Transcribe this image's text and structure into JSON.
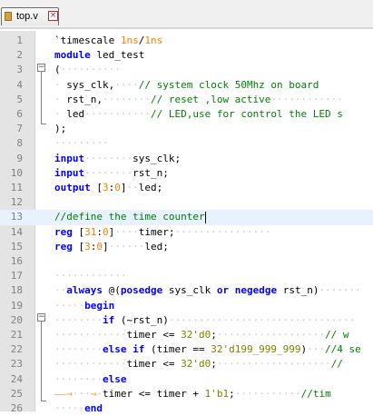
{
  "tab": {
    "label": "top.v",
    "close_label": "×"
  },
  "lines": [
    {
      "n": "1",
      "parts": [
        [
          "",
          "`timescale "
        ],
        [
          "num",
          "1ns"
        ],
        [
          "",
          "/"
        ],
        [
          "num",
          "1ns"
        ]
      ]
    },
    {
      "n": "2",
      "parts": [
        [
          "kw",
          "module"
        ],
        [
          "",
          " led_test"
        ]
      ]
    },
    {
      "n": "3",
      "parts": [
        [
          "",
          "("
        ],
        [
          "ws",
          "··········"
        ]
      ]
    },
    {
      "n": "4",
      "parts": [
        [
          "ws",
          "·"
        ],
        [
          "",
          " sys_clk,"
        ],
        [
          "ws",
          "····"
        ],
        [
          "cmt",
          "// system clock 50Mhz on board"
        ]
      ]
    },
    {
      "n": "5",
      "parts": [
        [
          "ws",
          "·"
        ],
        [
          "",
          " rst_n,"
        ],
        [
          "ws",
          "········"
        ],
        [
          "cmt",
          "// reset ,low active"
        ],
        [
          "ws",
          "············"
        ]
      ]
    },
    {
      "n": "6",
      "parts": [
        [
          "ws",
          "·"
        ],
        [
          "",
          " led"
        ],
        [
          "ws",
          "···········"
        ],
        [
          "cmt",
          "// LED,use for control the LED s"
        ]
      ]
    },
    {
      "n": "7",
      "parts": [
        [
          "",
          ");"
        ]
      ]
    },
    {
      "n": "8",
      "parts": [
        [
          "ws",
          "·········"
        ]
      ]
    },
    {
      "n": "9",
      "parts": [
        [
          "kw",
          "input"
        ],
        [
          "ws",
          "········"
        ],
        [
          "",
          "sys_clk;"
        ]
      ]
    },
    {
      "n": "10",
      "parts": [
        [
          "kw",
          "input"
        ],
        [
          "ws",
          "········"
        ],
        [
          "",
          "rst_n;"
        ]
      ]
    },
    {
      "n": "11",
      "parts": [
        [
          "kw",
          "output"
        ],
        [
          "",
          " ["
        ],
        [
          "num",
          "3"
        ],
        [
          "",
          ":"
        ],
        [
          "num",
          "0"
        ],
        [
          "",
          "]"
        ],
        [
          "ws",
          "··"
        ],
        [
          "",
          "led;"
        ]
      ]
    },
    {
      "n": "12",
      "parts": []
    },
    {
      "n": "13",
      "parts": [
        [
          "cmt",
          "//define the time counter"
        ]
      ],
      "highlight": true
    },
    {
      "n": "14",
      "parts": [
        [
          "kw",
          "reg"
        ],
        [
          "",
          " ["
        ],
        [
          "num",
          "31"
        ],
        [
          "",
          ":"
        ],
        [
          "num",
          "0"
        ],
        [
          "",
          "]"
        ],
        [
          "ws",
          "····"
        ],
        [
          "",
          "timer;"
        ],
        [
          "ws",
          "················"
        ]
      ]
    },
    {
      "n": "15",
      "parts": [
        [
          "kw",
          "reg"
        ],
        [
          "",
          " ["
        ],
        [
          "num",
          "3"
        ],
        [
          "",
          ":"
        ],
        [
          "num",
          "0"
        ],
        [
          "",
          "]"
        ],
        [
          "ws",
          "······"
        ],
        [
          "",
          "led;"
        ]
      ]
    },
    {
      "n": "16",
      "parts": []
    },
    {
      "n": "17",
      "parts": [
        [
          "ws",
          "············"
        ]
      ]
    },
    {
      "n": "18",
      "parts": [
        [
          "ws",
          "··"
        ],
        [
          "kw",
          "always"
        ],
        [
          "",
          " @("
        ],
        [
          "kw",
          "posedge"
        ],
        [
          "",
          " sys_clk "
        ],
        [
          "kw",
          "or"
        ],
        [
          "",
          " "
        ],
        [
          "kw",
          "negedge"
        ],
        [
          "",
          " rst_n)"
        ],
        [
          "ws",
          "·······"
        ]
      ]
    },
    {
      "n": "19",
      "parts": [
        [
          "ws",
          "·····"
        ],
        [
          "kw",
          "begin"
        ]
      ]
    },
    {
      "n": "20",
      "parts": [
        [
          "ws",
          "········"
        ],
        [
          "kw",
          "if"
        ],
        [
          "",
          " (~rst_n)"
        ],
        [
          "ws",
          "·······························"
        ]
      ]
    },
    {
      "n": "21",
      "parts": [
        [
          "ws",
          "············"
        ],
        [
          "",
          "timer <= "
        ],
        [
          "str",
          "32'd0"
        ],
        [
          "",
          ";"
        ],
        [
          "ws",
          "··················"
        ],
        [
          "cmt",
          "// w"
        ]
      ]
    },
    {
      "n": "22",
      "parts": [
        [
          "ws",
          "········"
        ],
        [
          "kw",
          "else if"
        ],
        [
          "",
          " (timer == "
        ],
        [
          "str",
          "32'd199_999_999"
        ],
        [
          "",
          ")"
        ],
        [
          "ws",
          "···"
        ],
        [
          "cmt",
          "//4 se"
        ]
      ]
    },
    {
      "n": "23",
      "parts": [
        [
          "ws",
          "············"
        ],
        [
          "",
          "timer <= "
        ],
        [
          "str",
          "32'd0"
        ],
        [
          "",
          ";"
        ],
        [
          "ws",
          "···················"
        ],
        [
          "cmt",
          "//"
        ]
      ]
    },
    {
      "n": "24",
      "parts": [
        [
          "ws",
          "········"
        ],
        [
          "kw",
          "else"
        ]
      ]
    },
    {
      "n": "25",
      "parts": [
        [
          "tab-arrow",
          "——→"
        ],
        [
          "ws",
          "···"
        ],
        [
          "tab-arrow",
          "→"
        ],
        [
          "ws",
          "·"
        ],
        [
          "",
          "timer <= timer + "
        ],
        [
          "str",
          "1'b1"
        ],
        [
          "",
          ";"
        ],
        [
          "ws",
          "···········"
        ],
        [
          "cmt",
          "//tim"
        ]
      ]
    },
    {
      "n": "26",
      "parts": [
        [
          "ws",
          "·····"
        ],
        [
          "kw",
          "end"
        ]
      ]
    }
  ]
}
